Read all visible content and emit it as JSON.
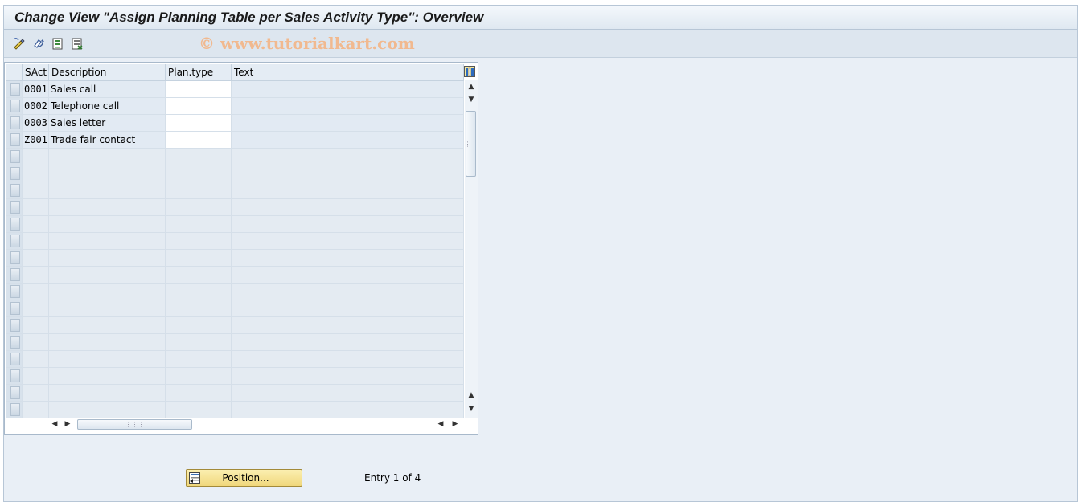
{
  "window": {
    "title": "Change View \"Assign Planning Table per Sales Activity Type\": Overview"
  },
  "toolbar": {
    "watermark": "© www.tutorialkart.com",
    "icons": [
      "display-change-icon",
      "undo-icon",
      "select-all-icon",
      "deselect-icon"
    ]
  },
  "table": {
    "columns": [
      "SAct",
      "Description",
      "Plan.type",
      "Text"
    ],
    "rows": [
      {
        "sact": "0001",
        "description": "Sales call",
        "plan_type": "",
        "text": ""
      },
      {
        "sact": "0002",
        "description": "Telephone call",
        "plan_type": "",
        "text": ""
      },
      {
        "sact": "0003",
        "description": "Sales letter",
        "plan_type": "",
        "text": ""
      },
      {
        "sact": "Z001",
        "description": "Trade fair contact",
        "plan_type": "",
        "text": ""
      }
    ],
    "empty_rows": 16
  },
  "footer": {
    "position_button_label": "Position...",
    "entry_info": "Entry 1 of 4"
  },
  "colors": {
    "background": "#e9eff6",
    "button_yellow": "#f0d77b",
    "watermark": "#f1b98f"
  }
}
